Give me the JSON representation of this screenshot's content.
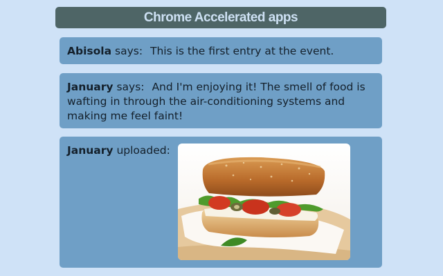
{
  "header": {
    "title": "Chrome Accelerated apps"
  },
  "feed": [
    {
      "author": "Abisola",
      "verb": "says:",
      "message": "This is the first entry at the event."
    },
    {
      "author": "January",
      "verb": "says:",
      "message": "And I'm enjoying it! The smell of food is wafting in through the air-conditioning systems and making me feel faint!"
    },
    {
      "author": "January",
      "verb": "uploaded:",
      "image": "sandwich-photo"
    }
  ]
}
